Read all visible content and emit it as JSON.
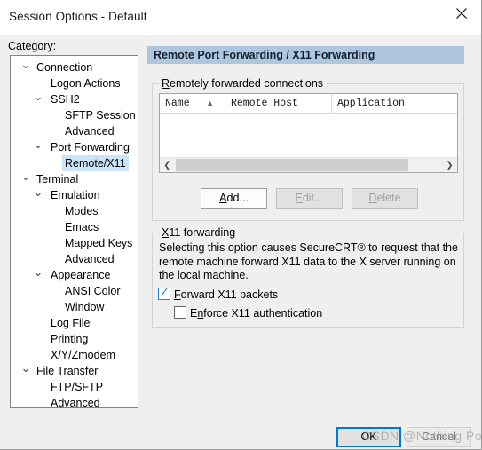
{
  "window": {
    "title": "Session Options - Default",
    "close_icon": "close-icon"
  },
  "category": {
    "label_prefix": "C",
    "label_rest": "ategory:",
    "tree": [
      {
        "label": "Connection",
        "level": 0,
        "chevron": "chevron-down",
        "selected": false
      },
      {
        "label": "Logon Actions",
        "level": 1,
        "chevron": "",
        "selected": false
      },
      {
        "label": "SSH2",
        "level": 1,
        "chevron": "chevron-down",
        "selected": false
      },
      {
        "label": "SFTP Session",
        "level": 2,
        "chevron": "",
        "selected": false
      },
      {
        "label": "Advanced",
        "level": 2,
        "chevron": "",
        "selected": false
      },
      {
        "label": "Port Forwarding",
        "level": 1,
        "chevron": "chevron-down",
        "selected": false
      },
      {
        "label": "Remote/X11",
        "level": 2,
        "chevron": "",
        "selected": true
      },
      {
        "label": "Terminal",
        "level": 0,
        "chevron": "chevron-down",
        "selected": false
      },
      {
        "label": "Emulation",
        "level": 1,
        "chevron": "chevron-down",
        "selected": false
      },
      {
        "label": "Modes",
        "level": 2,
        "chevron": "",
        "selected": false
      },
      {
        "label": "Emacs",
        "level": 2,
        "chevron": "",
        "selected": false
      },
      {
        "label": "Mapped Keys",
        "level": 2,
        "chevron": "",
        "selected": false
      },
      {
        "label": "Advanced",
        "level": 2,
        "chevron": "",
        "selected": false
      },
      {
        "label": "Appearance",
        "level": 1,
        "chevron": "chevron-down",
        "selected": false
      },
      {
        "label": "ANSI Color",
        "level": 2,
        "chevron": "",
        "selected": false
      },
      {
        "label": "Window",
        "level": 2,
        "chevron": "",
        "selected": false
      },
      {
        "label": "Log File",
        "level": 1,
        "chevron": "",
        "selected": false
      },
      {
        "label": "Printing",
        "level": 1,
        "chevron": "",
        "selected": false
      },
      {
        "label": "X/Y/Zmodem",
        "level": 1,
        "chevron": "",
        "selected": false
      },
      {
        "label": "File Transfer",
        "level": 0,
        "chevron": "chevron-down",
        "selected": false
      },
      {
        "label": "FTP/SFTP",
        "level": 1,
        "chevron": "",
        "selected": false
      },
      {
        "label": "Advanced",
        "level": 1,
        "chevron": "",
        "selected": false
      }
    ]
  },
  "page": {
    "header": "Remote Port Forwarding / X11 Forwarding",
    "remote_group": {
      "title_accel": "R",
      "title_rest": "emotely forwarded connections",
      "columns": [
        {
          "label": "Name",
          "sort": "ascending-sort-icon"
        },
        {
          "label": "Remote Host",
          "sort": ""
        },
        {
          "label": "Application",
          "sort": ""
        }
      ],
      "rows": [],
      "buttons": {
        "add_accel": "A",
        "add_rest": "dd...",
        "edit_accel": "E",
        "edit_rest": "dit...",
        "delete_accel": "D",
        "delete_rest": "elete"
      },
      "scrollbar": {
        "left_arrow": "❮",
        "right_arrow": "❯"
      }
    },
    "x11_group": {
      "title_accel": "X",
      "title_rest": "11 forwarding",
      "description": "Selecting this option causes SecureCRT® to request that the remote machine forward X11 data to the X server running on the local machine.",
      "checkboxes": [
        {
          "accel": "F",
          "rest": "orward X11 packets",
          "checked": true,
          "tick": "✓"
        },
        {
          "accel_pre": "E",
          "accel": "n",
          "rest": "force X11 authentication",
          "checked": false,
          "tick": ""
        }
      ]
    }
  },
  "footer": {
    "ok_label": "OK",
    "cancel_label": "Cancel",
    "watermark": "CSDN @Nothing Power"
  },
  "colors": {
    "header_bar": "#aec6de",
    "selection": "#cce4f7",
    "focus_border": "#0078d7",
    "checkbox_accent": "#2a7fd4",
    "dialog_bg": "#efefef"
  }
}
